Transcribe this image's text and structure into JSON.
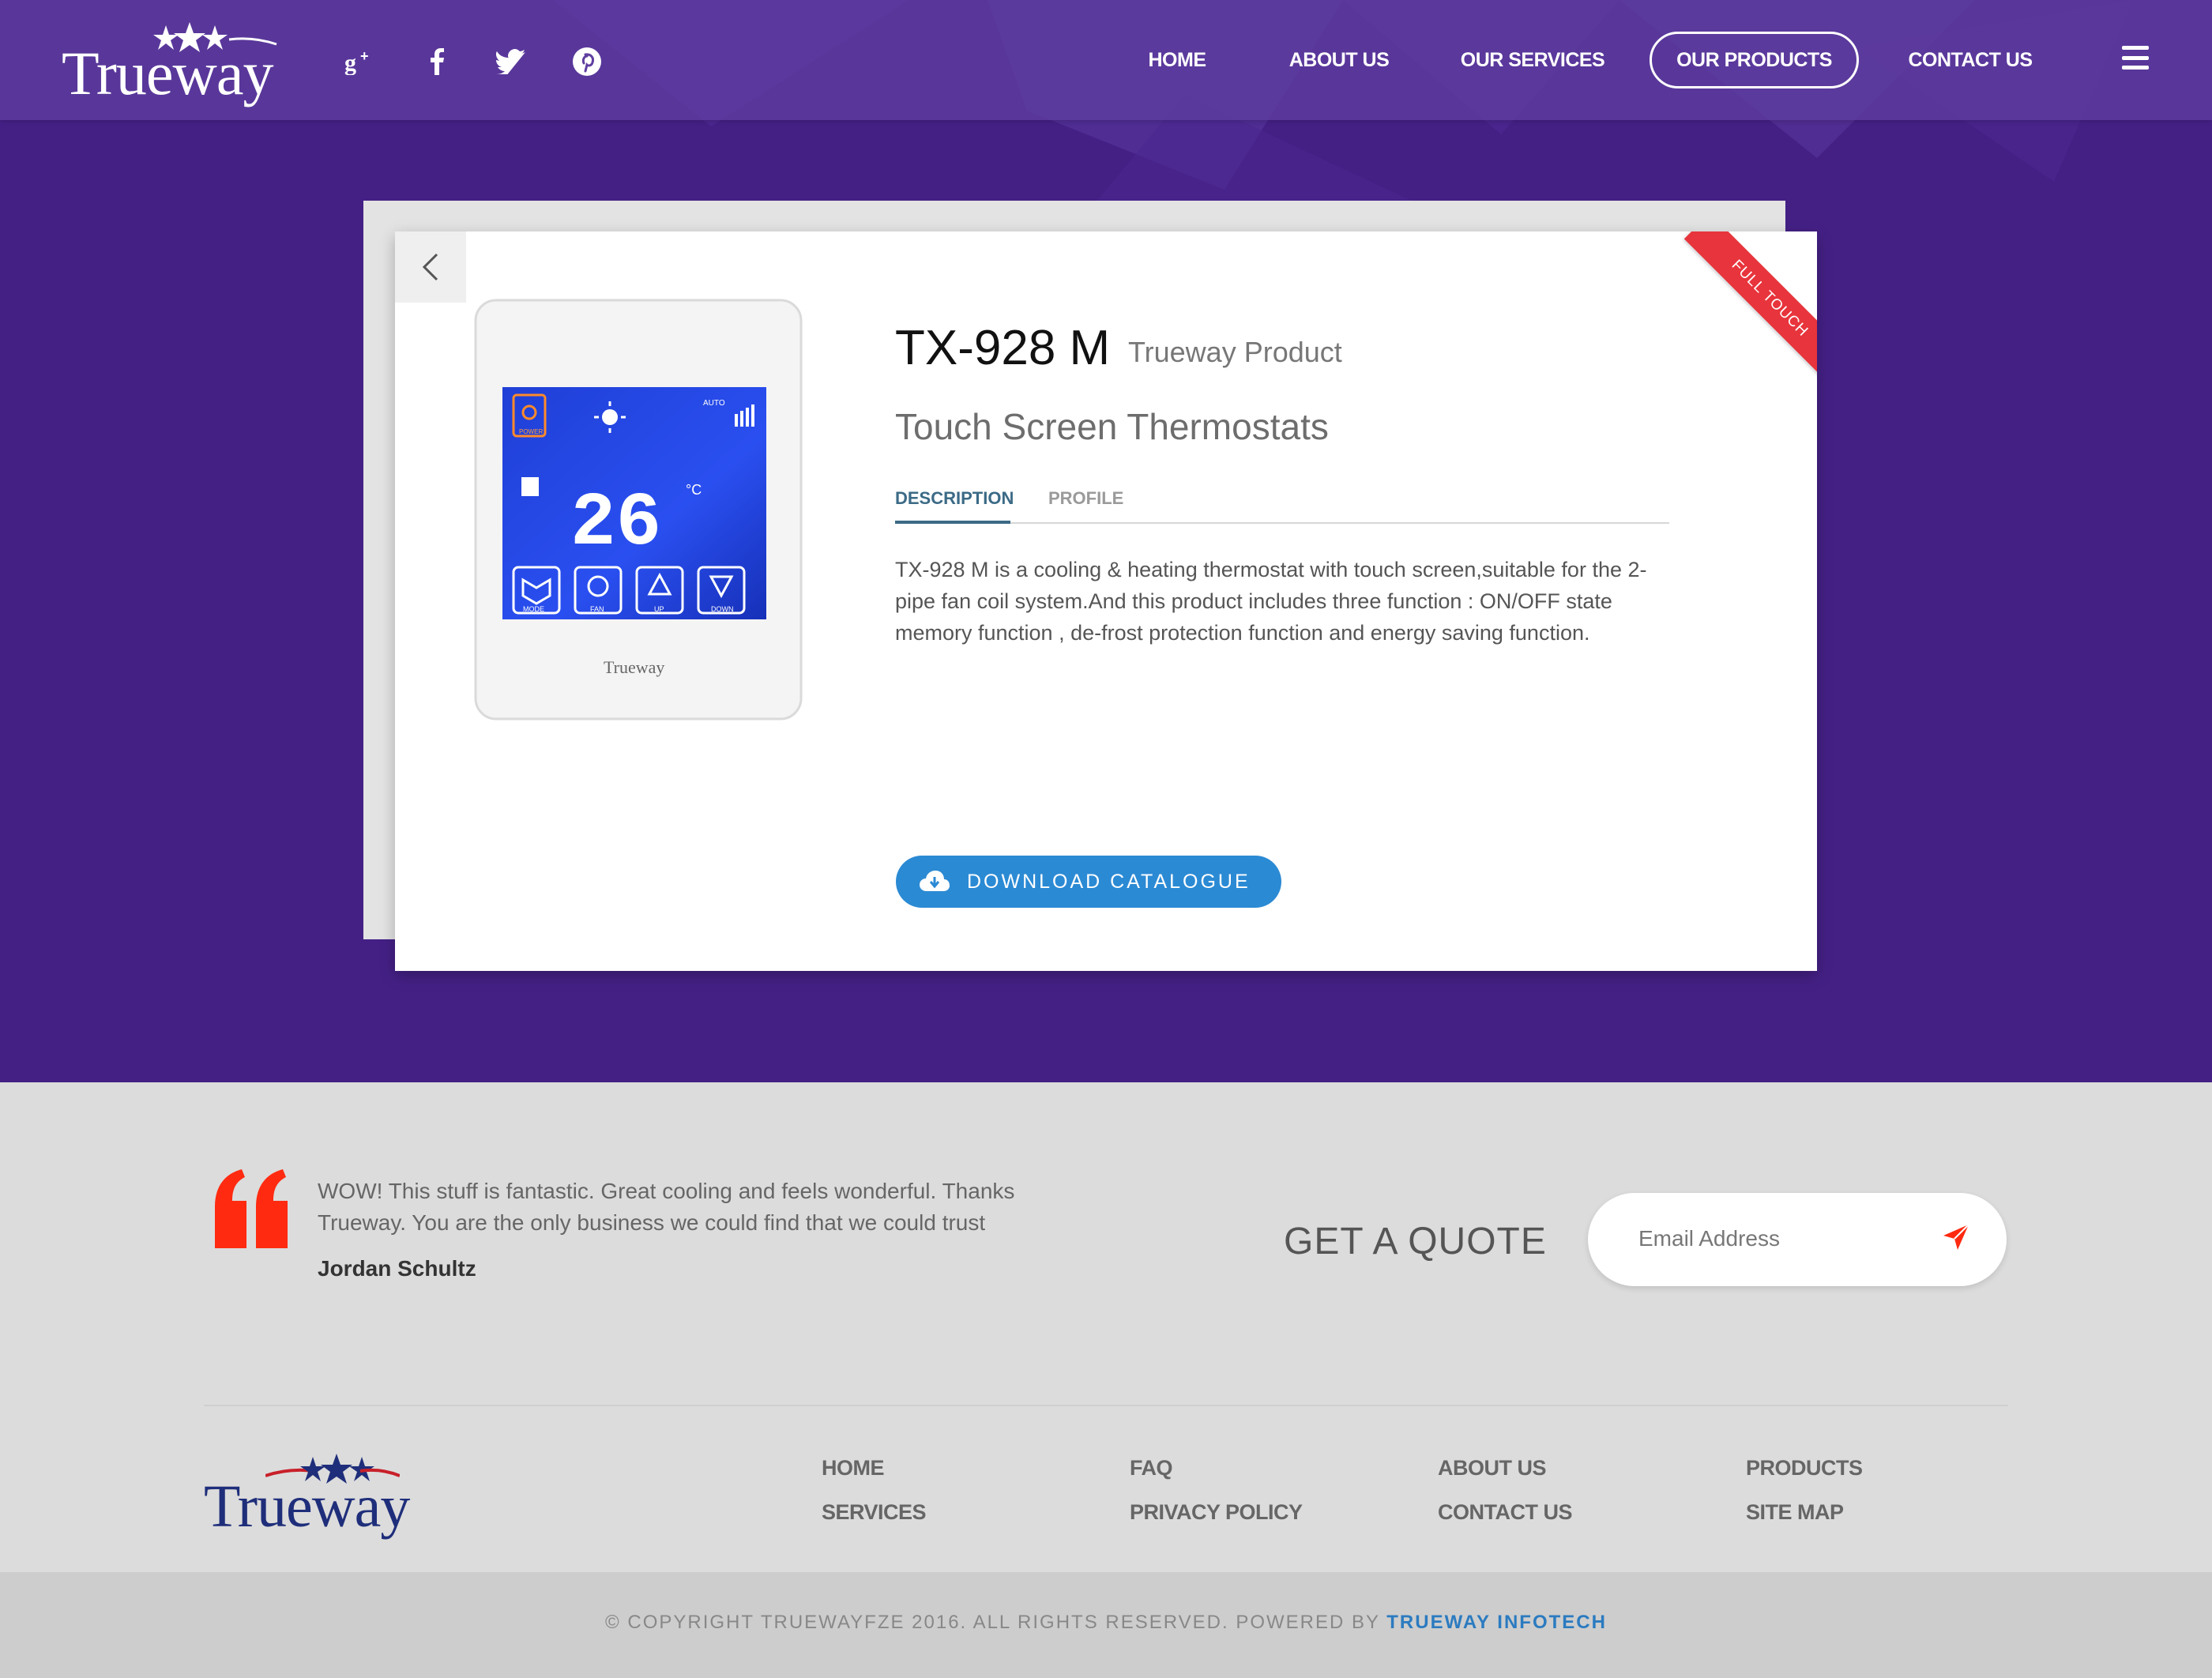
{
  "header": {
    "logo_text": "Trueway",
    "nav": [
      {
        "label": "HOME"
      },
      {
        "label": "ABOUT US"
      },
      {
        "label": "OUR SERVICES"
      },
      {
        "label": "OUR PRODUCTS"
      },
      {
        "label": "CONTACT US"
      }
    ],
    "social": [
      "google-plus-icon",
      "facebook-icon",
      "twitter-icon",
      "pinterest-icon"
    ]
  },
  "product": {
    "model": "TX-928 M",
    "brand": "Trueway Product",
    "category": "Touch Screen Thermostats",
    "ribbon": "FULL TOUCH",
    "tabs": [
      {
        "label": "DESCRIPTION",
        "active": true
      },
      {
        "label": "PROFILE",
        "active": false
      }
    ],
    "description": "TX-928 M is a cooling & heating thermostat with touch screen,suitable for the 2-pipe fan coil system.And this product includes three function : ON/OFF state memory function , de-frost protection function and energy saving function.",
    "download_label": "DOWNLOAD CATALOGUE",
    "device": {
      "temperature": "26",
      "unit": "°C",
      "buttons": [
        "MODE",
        "FAN",
        "UP",
        "DOWN"
      ],
      "power_label": "POWER",
      "auto_label": "AUTO",
      "brand": "Trueway"
    }
  },
  "testimonial": {
    "text": "WOW! This stuff is fantastic. Great cooling and feels wonderful. Thanks Trueway. You are the only business we could find that we could trust",
    "author": "Jordan Schultz"
  },
  "quote": {
    "title": "GET A QUOTE",
    "placeholder": "Email Address"
  },
  "footer": {
    "logo_text": "Trueway",
    "links": [
      [
        "HOME",
        "SERVICES"
      ],
      [
        "FAQ",
        "PRIVACY POLICY"
      ],
      [
        "ABOUT US",
        "CONTACT US"
      ],
      [
        "PRODUCTS",
        "SITE MAP"
      ]
    ],
    "copyright": "© COPYRIGHT TRUEWAYFZE 2016. ALL RIGHTS RESERVED. POWERED BY",
    "powered_by": "TRUEWAY INFOTECH"
  },
  "colors": {
    "hero": "#442085",
    "accent_blue": "#2b8ad4",
    "ribbon_red": "#e8343c",
    "quote_red": "#ff2a10"
  }
}
